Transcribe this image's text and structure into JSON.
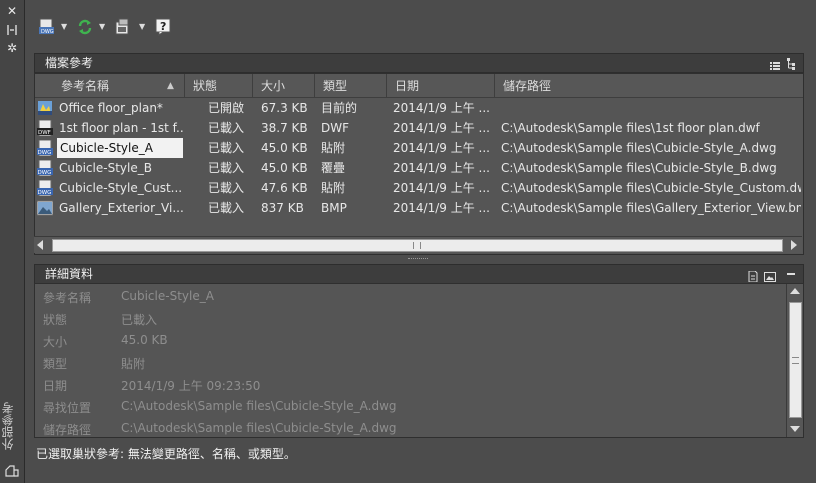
{
  "palette": {
    "title": "外部參考"
  },
  "toolbar": {
    "attach_icon": "attach-dwf-icon",
    "refresh_icon": "refresh-icon",
    "change_path_icon": "change-path-icon",
    "help_icon": "help-icon"
  },
  "file_references": {
    "title": "檔案參考",
    "columns": [
      "參考名稱",
      "狀態",
      "大小",
      "類型",
      "日期",
      "儲存路徑"
    ],
    "rows": [
      {
        "name": "Office floor_plan*",
        "status": "已開啟",
        "size": "67.3 KB",
        "type": "目前的",
        "date": "2014/1/9 上午 ...",
        "path": "",
        "icon": "dwg-current-icon"
      },
      {
        "name": "1st floor plan - 1st f...",
        "status": "已載入",
        "size": "38.7 KB",
        "type": "DWF",
        "date": "2014/1/9 上午 ...",
        "path": "C:\\Autodesk\\Sample files\\1st floor plan.dwf",
        "icon": "dwf-icon"
      },
      {
        "name": "Cubicle-Style_A",
        "status": "已載入",
        "size": "45.0 KB",
        "type": "貼附",
        "date": "2014/1/9 上午 ...",
        "path": "C:\\Autodesk\\Sample files\\Cubicle-Style_A.dwg",
        "icon": "dwg-icon",
        "selected": true
      },
      {
        "name": "Cubicle-Style_B",
        "status": "已載入",
        "size": "45.0 KB",
        "type": "覆疊",
        "date": "2014/1/9 上午 ...",
        "path": "C:\\Autodesk\\Sample files\\Cubicle-Style_B.dwg",
        "icon": "dwg-icon"
      },
      {
        "name": "Cubicle-Style_Cust...",
        "status": "已載入",
        "size": "47.6 KB",
        "type": "貼附",
        "date": "2014/1/9 上午 ...",
        "path": "C:\\Autodesk\\Sample files\\Cubicle-Style_Custom.dwg",
        "icon": "dwg-icon"
      },
      {
        "name": "Gallery_Exterior_Vi...",
        "status": "已載入",
        "size": "837 KB",
        "type": "BMP",
        "date": "2014/1/9 上午 ...",
        "path": "C:\\Autodesk\\Sample files\\Gallery_Exterior_View.bmp",
        "icon": "image-icon"
      }
    ]
  },
  "details": {
    "title": "詳細資料",
    "fields": [
      {
        "label": "參考名稱",
        "value": "Cubicle-Style_A"
      },
      {
        "label": "狀態",
        "value": "已載入"
      },
      {
        "label": "大小",
        "value": "45.0 KB"
      },
      {
        "label": "類型",
        "value": "貼附"
      },
      {
        "label": "日期",
        "value": "2014/1/9 上午 09:23:50"
      },
      {
        "label": "尋找位置",
        "value": "C:\\Autodesk\\Sample files\\Cubicle-Style_A.dwg"
      },
      {
        "label": "儲存路徑",
        "value": "C:\\Autodesk\\Sample files\\Cubicle-Style_A.dwg"
      }
    ]
  },
  "status_message": "已選取巢狀參考: 無法變更路徑、名稱、或類型。"
}
